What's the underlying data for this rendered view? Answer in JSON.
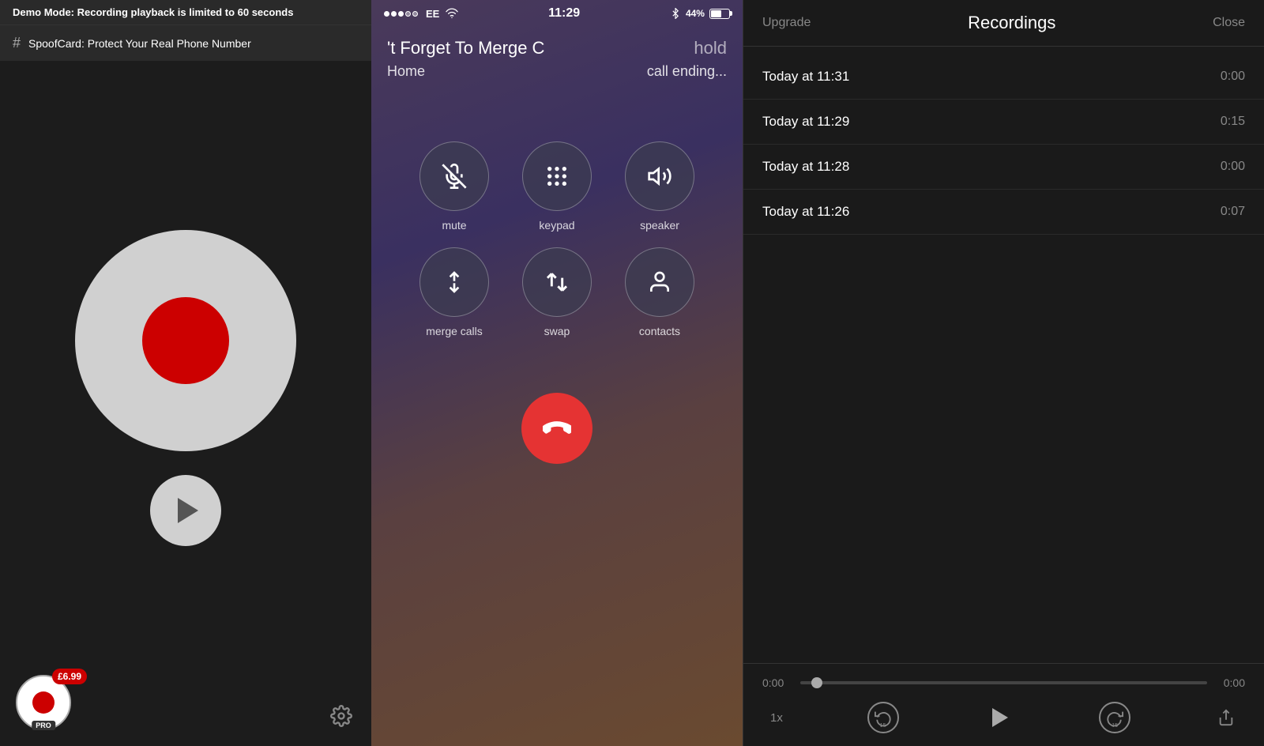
{
  "leftPanel": {
    "demoBanner": {
      "prefix": "Demo Mode:",
      "text": " Recording playback is limited to 60 seconds"
    },
    "spoofBar": {
      "text": "SpoofCard: Protect Your Real Phone Number"
    },
    "priceBadge": "£6.99",
    "proLabel": "PRO",
    "gearLabel": "Settings"
  },
  "middlePanel": {
    "statusBar": {
      "carrier": "EE",
      "time": "11:29",
      "battery": "44%"
    },
    "callTitle": "'t Forget To Merge C",
    "callHold": "hold",
    "callSub1": "Home",
    "callSub2": "call ending...",
    "buttons": [
      {
        "icon": "🎙️",
        "label": "mute",
        "name": "mute-button",
        "strikethrough": true
      },
      {
        "icon": "⠿",
        "label": "keypad",
        "name": "keypad-button"
      },
      {
        "icon": "🔊",
        "label": "speaker",
        "name": "speaker-button"
      },
      {
        "icon": "⇈",
        "label": "merge calls",
        "name": "merge-calls-button"
      },
      {
        "icon": "⇅",
        "label": "swap",
        "name": "swap-button"
      },
      {
        "icon": "👤",
        "label": "contacts",
        "name": "contacts-button"
      }
    ],
    "endCall": "End Call"
  },
  "rightPanel": {
    "header": {
      "upgradeLabel": "Upgrade",
      "title": "Recordings",
      "closeLabel": "Close"
    },
    "recordings": [
      {
        "time": "Today at 11:31",
        "duration": "0:00"
      },
      {
        "time": "Today at 11:29",
        "duration": "0:15"
      },
      {
        "time": "Today at 11:28",
        "duration": "0:00"
      },
      {
        "time": "Today at 11:26",
        "duration": "0:07"
      }
    ],
    "player": {
      "currentTime": "0:00",
      "totalTime": "0:00",
      "speed": "1x",
      "rewindSec": "15",
      "forwardSec": "15"
    }
  }
}
